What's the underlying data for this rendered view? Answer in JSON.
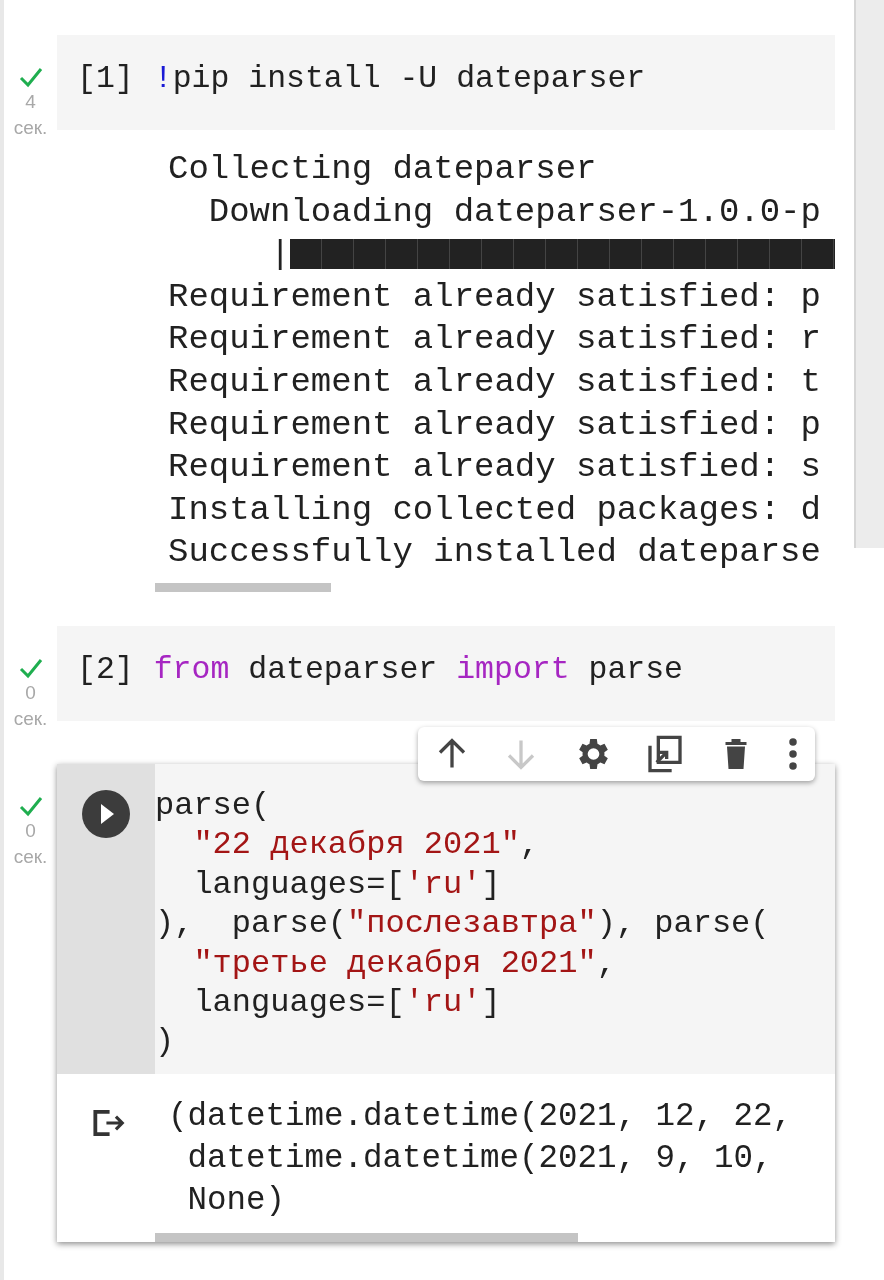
{
  "cells": [
    {
      "selected": false,
      "prompt": "[1]",
      "time": "4",
      "time_unit": "сек.",
      "code": [
        [
          {
            "kind": "shell",
            "text": "!"
          },
          {
            "kind": "plain",
            "text": "pip install -U dateparser"
          }
        ]
      ],
      "output": {
        "lines": [
          {
            "kind": "text",
            "text": "Collecting dateparser"
          },
          {
            "kind": "text",
            "text": "  Downloading dateparser-1.0.0-p"
          },
          {
            "kind": "progress",
            "text": "     |"
          },
          {
            "kind": "text",
            "text": "Requirement already satisfied: p"
          },
          {
            "kind": "text",
            "text": "Requirement already satisfied: r"
          },
          {
            "kind": "text",
            "text": "Requirement already satisfied: t"
          },
          {
            "kind": "text",
            "text": "Requirement already satisfied: p"
          },
          {
            "kind": "text",
            "text": "Requirement already satisfied: s"
          },
          {
            "kind": "text",
            "text": "Installing collected packages: d"
          },
          {
            "kind": "text",
            "text": "Successfully installed dateparse"
          }
        ]
      }
    },
    {
      "selected": false,
      "prompt": "[2]",
      "time": "0",
      "time_unit": "сек.",
      "code": [
        [
          {
            "kind": "keyword",
            "text": "from"
          },
          {
            "kind": "plain",
            "text": " dateparser "
          },
          {
            "kind": "keyword",
            "text": "import"
          },
          {
            "kind": "plain",
            "text": " parse"
          }
        ]
      ]
    },
    {
      "selected": true,
      "time": "0",
      "time_unit": "сек.",
      "code": [
        [
          {
            "kind": "plain",
            "text": "parse("
          }
        ],
        [
          {
            "kind": "string",
            "text": "  \"22 декабря 2021\""
          },
          {
            "kind": "plain",
            "text": ","
          }
        ],
        [
          {
            "kind": "plain",
            "text": "  languages=["
          },
          {
            "kind": "string",
            "text": "'ru'"
          },
          {
            "kind": "plain",
            "text": "]"
          }
        ],
        [
          {
            "kind": "plain",
            "text": "),  parse("
          },
          {
            "kind": "string",
            "text": "\"послезавтра\""
          },
          {
            "kind": "plain",
            "text": "), parse("
          }
        ],
        [
          {
            "kind": "string",
            "text": "  \"третье декабря 2021\""
          },
          {
            "kind": "plain",
            "text": ","
          }
        ],
        [
          {
            "kind": "plain",
            "text": "  languages=["
          },
          {
            "kind": "string",
            "text": "'ru'"
          },
          {
            "kind": "plain",
            "text": "]"
          }
        ],
        [
          {
            "kind": "plain",
            "text": ")"
          }
        ]
      ],
      "output": {
        "lines": [
          {
            "kind": "text",
            "text": "(datetime.datetime(2021, 12, 22,"
          },
          {
            "kind": "text",
            "text": " datetime.datetime(2021, 9, 10,"
          },
          {
            "kind": "text",
            "text": " None)"
          }
        ]
      }
    }
  ],
  "toolbar": [
    {
      "kind": "up",
      "disabled": false
    },
    {
      "kind": "down",
      "disabled": true
    },
    {
      "kind": "settings",
      "disabled": false
    },
    {
      "kind": "mirror",
      "disabled": false
    },
    {
      "kind": "delete",
      "disabled": false
    },
    {
      "kind": "more",
      "disabled": false
    }
  ]
}
